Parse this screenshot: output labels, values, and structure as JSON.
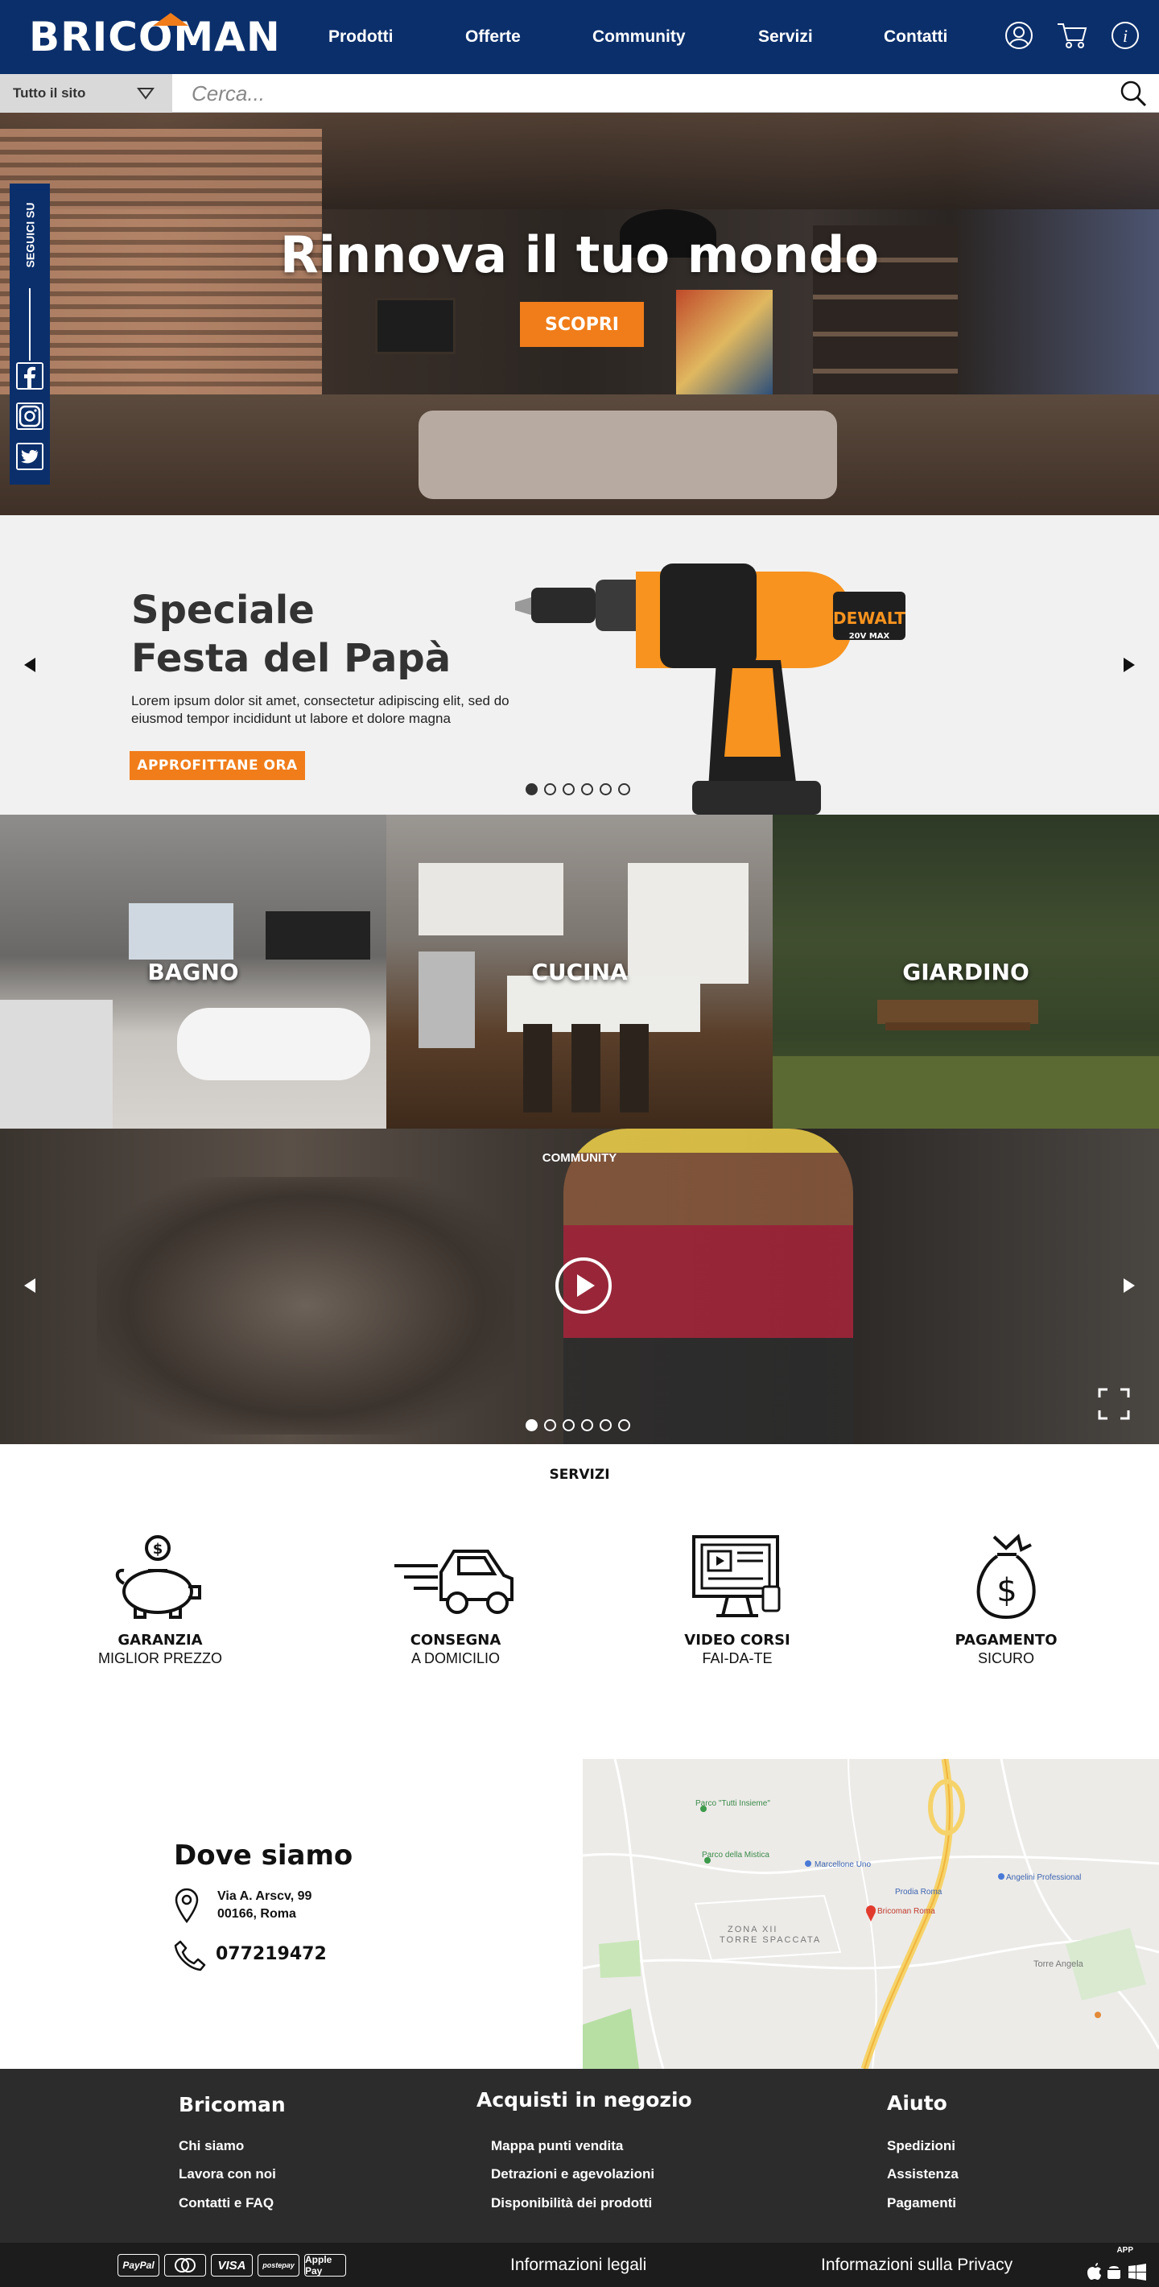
{
  "brand": {
    "logo_text": "BRICOMAN",
    "primary_color": "#0b2f6b",
    "accent_color": "#f07d1a"
  },
  "nav": {
    "items": [
      "Prodotti",
      "Offerte",
      "Community",
      "Servizi",
      "Contatti"
    ]
  },
  "header_icons": [
    "user-icon",
    "cart-icon",
    "info-icon"
  ],
  "search": {
    "scope": "Tutto il sito",
    "placeholder": "Cerca..."
  },
  "hero": {
    "title": "Rinnova il tuo mondo",
    "button": "SCOPRI"
  },
  "social": {
    "label": "SEGUICI SU",
    "networks": [
      "facebook-icon",
      "instagram-icon",
      "twitter-icon"
    ]
  },
  "promo": {
    "title_line1": "Speciale",
    "title_line2": "Festa del Papà",
    "text": "Lorem ipsum dolor sit amet, consectetur adipiscing elit, sed do eiusmod tempor incididunt ut labore et dolore magna",
    "button": "APPROFITTANE ORA",
    "drill_brand": "DEWALT",
    "drill_model": "20V MAX",
    "slides": 6,
    "active_slide": 1
  },
  "categories": [
    "BAGNO",
    "CUCINA",
    "GIARDINO"
  ],
  "community": {
    "label": "COMMUNITY",
    "slides": 6,
    "active_slide": 1
  },
  "services": {
    "title": "SERVIZI",
    "items": [
      {
        "title": "GARANZIA",
        "sub": "MIGLIOR PREZZO",
        "icon": "piggy-bank-icon"
      },
      {
        "title": "CONSEGNA",
        "sub": "A DOMICILIO",
        "icon": "delivery-truck-icon"
      },
      {
        "title": "VIDEO CORSI",
        "sub": "FAI-DA-TE",
        "icon": "video-course-icon"
      },
      {
        "title": "PAGAMENTO",
        "sub": "SICURO",
        "icon": "money-bag-icon"
      }
    ]
  },
  "location": {
    "title": "Dove siamo",
    "address_line1": "Via A. Arscv, 99",
    "address_line2": "00166, Roma",
    "phone": "077219472",
    "map_labels": [
      "Parco \"Tutti Insieme\"",
      "Parco della Mistica",
      "Marcellone Uno",
      "Prodia Roma",
      "Bricoman Roma",
      "ZONA XII",
      "TORRE SPACCATA",
      "Torre Angela",
      "Angelini Professional"
    ]
  },
  "footer": {
    "col1": {
      "title": "Bricoman",
      "links": [
        "Chi siamo",
        "Lavora con noi",
        "Contatti e FAQ"
      ]
    },
    "col2": {
      "title": "Acquisti in negozio",
      "links": [
        "Mappa punti vendita",
        "Detrazioni e agevolazioni",
        "Disponibilità dei prodotti"
      ]
    },
    "col3": {
      "title": "Aiuto",
      "links": [
        "Spedizioni",
        "Assistenza",
        "Pagamenti"
      ]
    }
  },
  "bottom": {
    "payments": [
      "PayPal",
      "Mastercard",
      "VISA",
      "postepay",
      "Apple Pay"
    ],
    "legal": "Informazioni legali",
    "privacy": "Informazioni sulla Privacy",
    "app_label": "APP"
  }
}
